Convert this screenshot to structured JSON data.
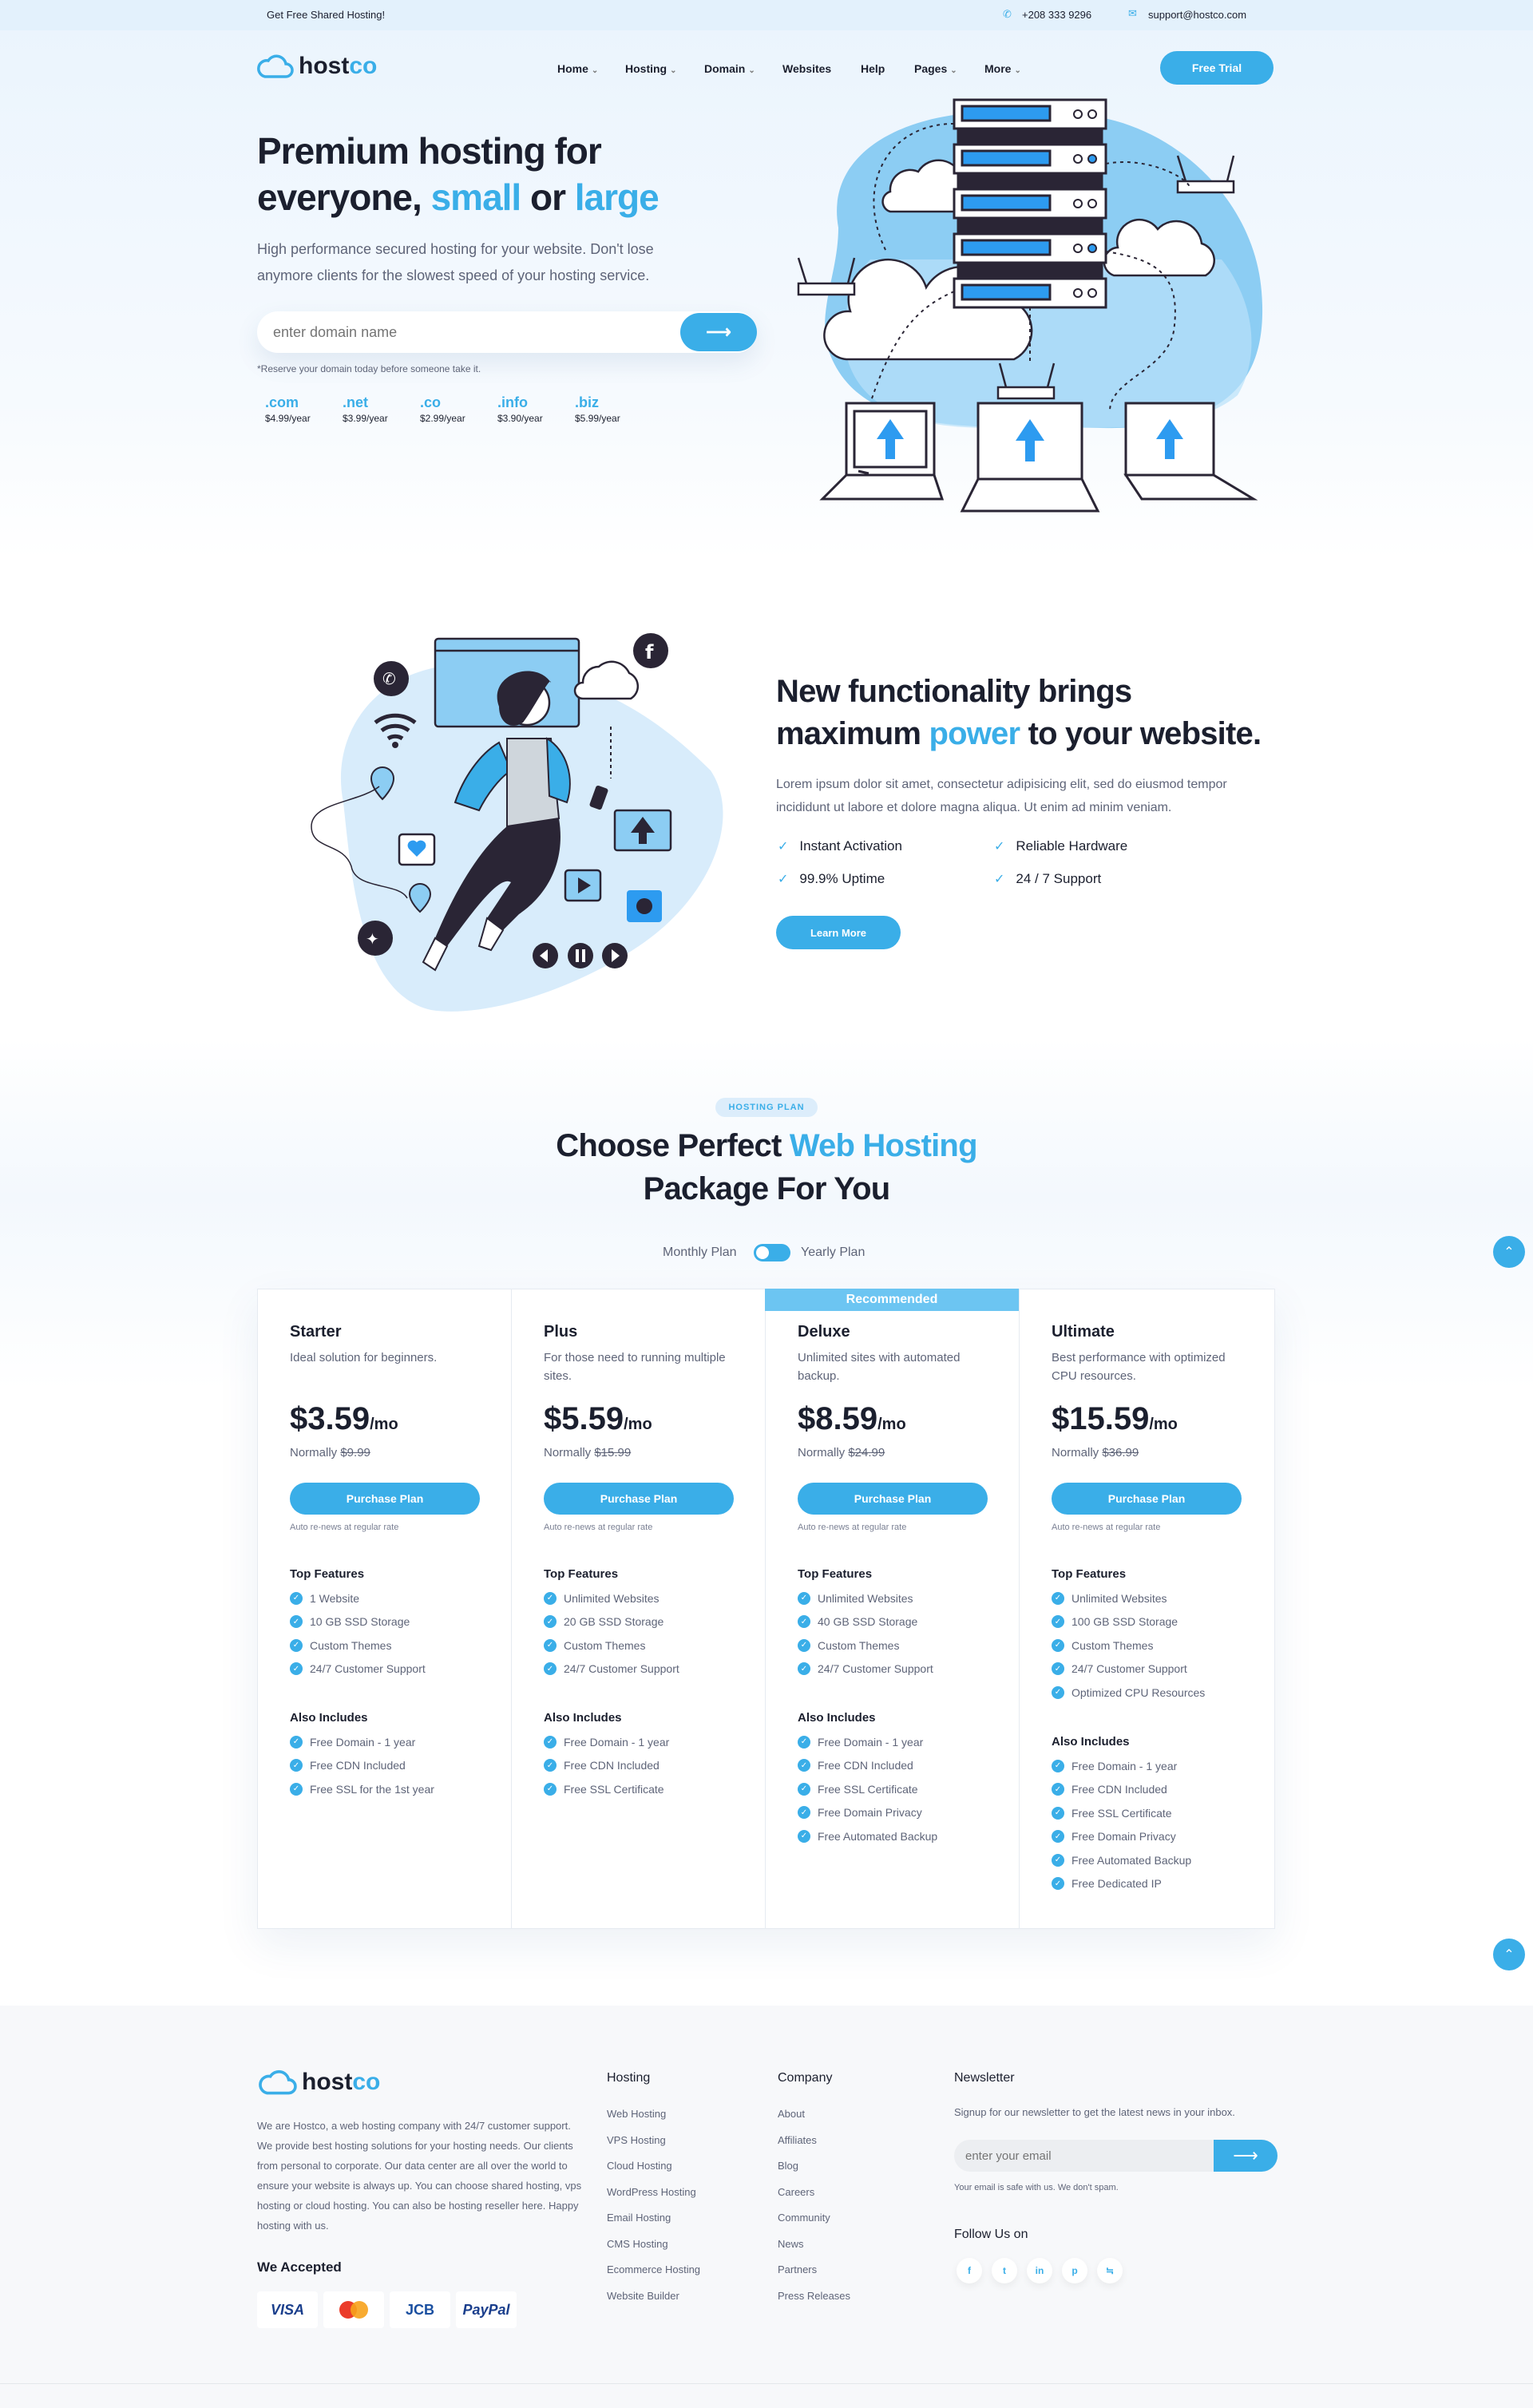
{
  "topbar": {
    "promo": "Get Free Shared Hosting!",
    "phone": "+208 333 9296",
    "email": "support@hostco.com"
  },
  "brand": {
    "name_part1": "host",
    "name_part2": "co"
  },
  "nav": {
    "items": [
      "Home",
      "Hosting",
      "Domain",
      "Websites",
      "Help",
      "Pages",
      "More"
    ],
    "cta": "Free Trial"
  },
  "hero": {
    "title_line1": "Premium hosting for",
    "title_l2_a": "everyone, ",
    "title_l2_b": "small",
    "title_l2_c": " or ",
    "title_l2_d": "large",
    "subtitle": "High performance secured hosting for your website. Don't lose anymore clients for the slowest speed of your hosting service.",
    "search_placeholder": "enter domain name",
    "note": "*Reserve your domain today before someone take it.",
    "tlds": [
      {
        "name": ".com",
        "price": "$4.99/year"
      },
      {
        "name": ".net",
        "price": "$3.99/year"
      },
      {
        "name": ".co",
        "price": "$2.99/year"
      },
      {
        "name": ".info",
        "price": "$3.90/year"
      },
      {
        "name": ".biz",
        "price": "$5.99/year"
      }
    ]
  },
  "features": {
    "title_line1": "New functionality brings",
    "title_l2_a": "maximum ",
    "title_l2_b": "power",
    "title_l2_c": " to your website.",
    "body": "Lorem ipsum dolor sit amet, consectetur adipisicing elit, sed do eiusmod tempor incididunt ut labore et dolore magna aliqua. Ut enim ad minim veniam.",
    "items": [
      "Instant Activation",
      "Reliable Hardware",
      "99.9% Uptime",
      "24 / 7 Support"
    ],
    "button": "Learn More"
  },
  "pricing": {
    "badge": "HOSTING PLAN",
    "title_l1_a": "Choose Perfect ",
    "title_l1_b": "Web Hosting",
    "title_line2": "Package For You",
    "toggle_left": "Monthly Plan",
    "toggle_right": "Yearly Plan",
    "recommended": "Recommended",
    "top_features_label": "Top Features",
    "also_includes_label": "Also Includes",
    "plans": [
      {
        "name": "Starter",
        "desc": "Ideal solution for beginners.",
        "price": "$3.59",
        "unit": "/mo",
        "normal_label": "Normally ",
        "normal_price": "$9.99",
        "button": "Purchase Plan",
        "renew": "Auto re-news at regular rate",
        "top": [
          "1 Website",
          "10 GB SSD Storage",
          "Custom Themes",
          "24/7 Customer Support"
        ],
        "also": [
          "Free Domain - 1 year",
          "Free CDN Included",
          "Free SSL for the 1st year"
        ]
      },
      {
        "name": "Plus",
        "desc": "For those need to running multiple sites.",
        "price": "$5.59",
        "unit": "/mo",
        "normal_label": "Normally ",
        "normal_price": "$15.99",
        "button": "Purchase Plan",
        "renew": "Auto re-news at regular rate",
        "top": [
          "Unlimited Websites",
          "20 GB SSD Storage",
          "Custom Themes",
          "24/7 Customer Support"
        ],
        "also": [
          "Free Domain - 1 year",
          "Free CDN Included",
          "Free SSL Certificate"
        ]
      },
      {
        "name": "Deluxe",
        "desc": "Unlimited sites with automated backup.",
        "price": "$8.59",
        "unit": "/mo",
        "normal_label": "Normally ",
        "normal_price": "$24.99",
        "button": "Purchase Plan",
        "renew": "Auto re-news at regular rate",
        "top": [
          "Unlimited Websites",
          "40 GB SSD Storage",
          "Custom Themes",
          "24/7 Customer Support"
        ],
        "also": [
          "Free Domain - 1 year",
          "Free CDN Included",
          "Free SSL Certificate",
          "Free Domain Privacy",
          "Free Automated Backup"
        ]
      },
      {
        "name": "Ultimate",
        "desc": "Best performance with optimized CPU resources.",
        "price": "$15.59",
        "unit": "/mo",
        "normal_label": "Normally ",
        "normal_price": "$36.99",
        "button": "Purchase Plan",
        "renew": "Auto re-news at regular rate",
        "top": [
          "Unlimited Websites",
          "100 GB SSD Storage",
          "Custom Themes",
          "24/7 Customer Support",
          "Optimized CPU Resources"
        ],
        "also": [
          "Free Domain - 1 year",
          "Free CDN Included",
          "Free SSL Certificate",
          "Free Domain Privacy",
          "Free Automated Backup",
          "Free Dedicated IP"
        ]
      }
    ]
  },
  "footer": {
    "about": "We are Hostco, a web hosting company with 24/7 customer support. We provide best hosting solutions for your hosting needs. Our clients from personal to corporate. Our data center are all over the world to ensure your website is always up. You can choose shared hosting, vps hosting or cloud hosting. You can also be hosting reseller here. Happy hosting with us.",
    "accepted_label": "We Accepted",
    "cards": [
      "VISA",
      "mastercard",
      "JCB",
      "PayPal"
    ],
    "hosting_title": "Hosting",
    "hosting_links": [
      "Web Hosting",
      "VPS Hosting",
      "Cloud Hosting",
      "WordPress Hosting",
      "Email Hosting",
      "CMS Hosting",
      "Ecommerce Hosting",
      "Website Builder"
    ],
    "company_title": "Company",
    "company_links": [
      "About",
      "Affiliates",
      "Blog",
      "Careers",
      "Community",
      "News",
      "Partners",
      "Press Releases"
    ],
    "newsletter_title": "Newsletter",
    "newsletter_text": "Signup for our newsletter to get the latest news in your inbox.",
    "email_placeholder": "enter your email",
    "spam_note": "Your email is safe with us. We don't spam.",
    "follow_title": "Follow Us on",
    "socials": [
      "facebook-icon",
      "twitter-icon",
      "linkedin-icon",
      "pinterest-icon",
      "rss-icon"
    ]
  },
  "colors": {
    "accent": "#3aaee8",
    "text": "#1b1f2e",
    "muted": "#5e6478"
  }
}
